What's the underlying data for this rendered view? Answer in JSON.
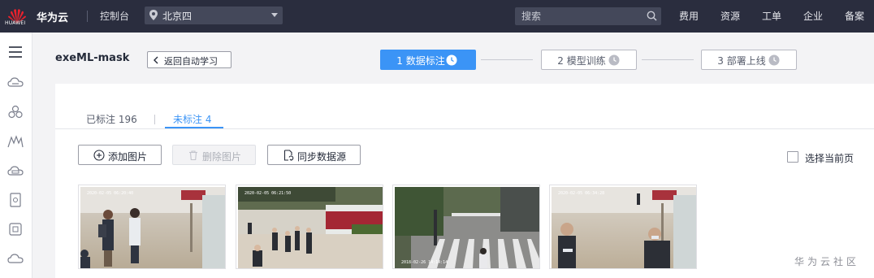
{
  "topbar": {
    "logo_text": "HUAWEI",
    "brand": "华为云",
    "console": "控制台",
    "region": "北京四",
    "search_placeholder": "搜索",
    "nav": [
      "费用",
      "资源",
      "工单",
      "企业",
      "备案"
    ]
  },
  "sidebar": {
    "icons": [
      "menu-icon",
      "cloud-server-icon",
      "cluster-icon",
      "mountains-icon",
      "cloud-disk-icon",
      "doc-icon",
      "chip-icon",
      "cloud-icon"
    ]
  },
  "header": {
    "title": "exeML-mask",
    "back_label": "返回自动学习",
    "steps": [
      {
        "label": "1 数据标注",
        "active": true
      },
      {
        "label": "2 模型训练",
        "active": false
      },
      {
        "label": "3 部署上线",
        "active": false
      }
    ]
  },
  "tabs": [
    {
      "label": "已标注 196",
      "active": false
    },
    {
      "label": "未标注 4",
      "active": true
    }
  ],
  "toolbar": {
    "add_label": "添加图片",
    "delete_label": "删除图片",
    "sync_label": "同步数据源",
    "select_page_label": "选择当前页"
  },
  "images": [
    {
      "name": "station-hall-people",
      "timestamp": "2020-02-05 06:20:40"
    },
    {
      "name": "square-crowd",
      "timestamp": "2020-02-05 06:21:50"
    },
    {
      "name": "gate-crosswalk",
      "timestamp": "2018-02-26 14:14:14"
    },
    {
      "name": "station-hall-masks",
      "timestamp": "2020-02-05 06:34:28"
    }
  ],
  "watermark": "华为云社区",
  "colors": {
    "topbar": "#2a2d3e",
    "accent": "#3b94f6"
  }
}
